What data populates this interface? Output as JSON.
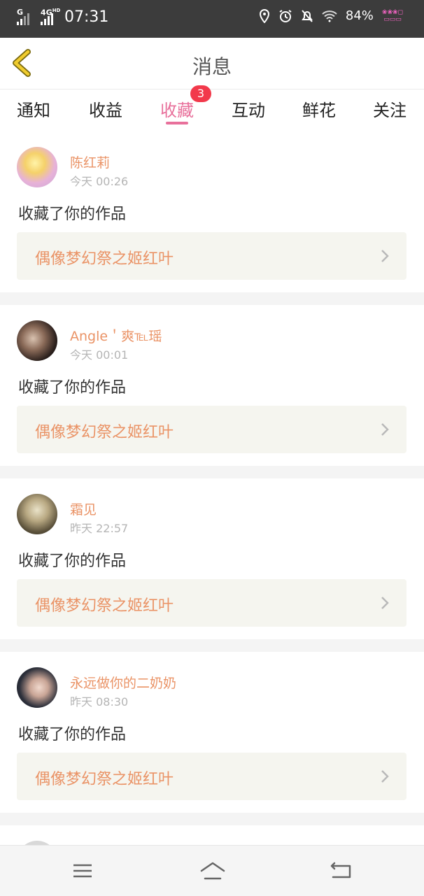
{
  "status_bar": {
    "net1": "G",
    "net2": "4G",
    "net2_sup": "HD",
    "time": "07:31",
    "battery": "84%",
    "icons": [
      "location-icon",
      "alarm-icon",
      "bell-off-icon",
      "wifi-icon"
    ]
  },
  "header": {
    "title": "消息",
    "back_icon": "back-chevron-icon"
  },
  "tabs": [
    {
      "label": "通知"
    },
    {
      "label": "收益"
    },
    {
      "label": "收藏",
      "badge": "3"
    },
    {
      "label": "互动"
    },
    {
      "label": "鲜花"
    },
    {
      "label": "关注"
    }
  ],
  "active_tab": "收藏",
  "items": [
    {
      "name": "陈红莉",
      "time": "今天 00:26",
      "action": "收藏了你的作品",
      "work": "偶像梦幻祭之姬红叶"
    },
    {
      "name": "Angle＇爽℡瑶",
      "time": "今天 00:01",
      "action": "收藏了你的作品",
      "work": "偶像梦幻祭之姬红叶"
    },
    {
      "name": "霜见",
      "time": "昨天 22:57",
      "action": "收藏了你的作品",
      "work": "偶像梦幻祭之姬红叶"
    },
    {
      "name": "永远做你的二奶奶",
      "time": "昨天 08:30",
      "action": "收藏了你的作品",
      "work": "偶像梦幻祭之姬红叶"
    }
  ],
  "nav": [
    "menu-icon",
    "home-icon",
    "back-icon"
  ],
  "colors": {
    "accent": "#e8709b",
    "orange": "#ea9366",
    "badge": "#f2394b",
    "status_bar": "#3c3c3c"
  }
}
